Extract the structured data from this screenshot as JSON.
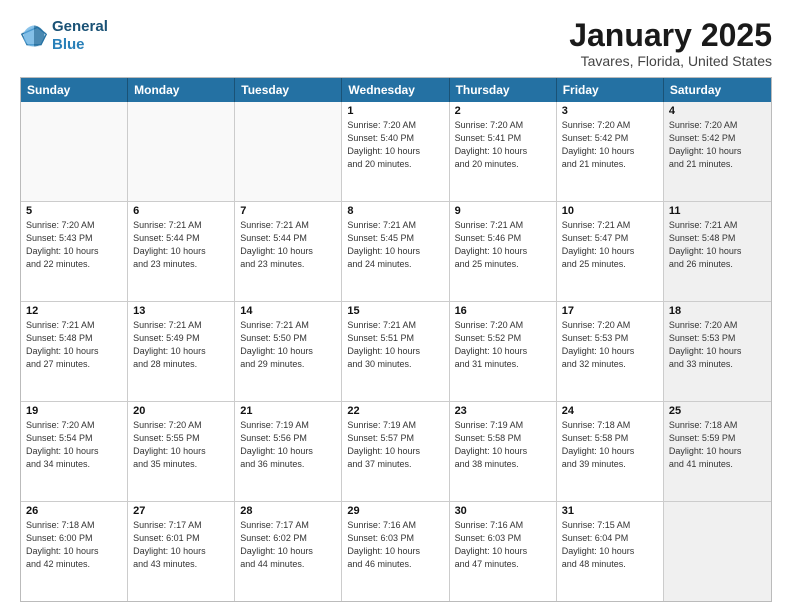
{
  "logo": {
    "line1": "General",
    "line2": "Blue"
  },
  "header": {
    "month": "January 2025",
    "location": "Tavares, Florida, United States"
  },
  "weekdays": [
    "Sunday",
    "Monday",
    "Tuesday",
    "Wednesday",
    "Thursday",
    "Friday",
    "Saturday"
  ],
  "rows": [
    [
      {
        "day": "",
        "info": "",
        "empty": true
      },
      {
        "day": "",
        "info": "",
        "empty": true
      },
      {
        "day": "",
        "info": "",
        "empty": true
      },
      {
        "day": "1",
        "info": "Sunrise: 7:20 AM\nSunset: 5:40 PM\nDaylight: 10 hours\nand 20 minutes."
      },
      {
        "day": "2",
        "info": "Sunrise: 7:20 AM\nSunset: 5:41 PM\nDaylight: 10 hours\nand 20 minutes."
      },
      {
        "day": "3",
        "info": "Sunrise: 7:20 AM\nSunset: 5:42 PM\nDaylight: 10 hours\nand 21 minutes."
      },
      {
        "day": "4",
        "info": "Sunrise: 7:20 AM\nSunset: 5:42 PM\nDaylight: 10 hours\nand 21 minutes.",
        "shaded": true
      }
    ],
    [
      {
        "day": "5",
        "info": "Sunrise: 7:20 AM\nSunset: 5:43 PM\nDaylight: 10 hours\nand 22 minutes."
      },
      {
        "day": "6",
        "info": "Sunrise: 7:21 AM\nSunset: 5:44 PM\nDaylight: 10 hours\nand 23 minutes."
      },
      {
        "day": "7",
        "info": "Sunrise: 7:21 AM\nSunset: 5:44 PM\nDaylight: 10 hours\nand 23 minutes."
      },
      {
        "day": "8",
        "info": "Sunrise: 7:21 AM\nSunset: 5:45 PM\nDaylight: 10 hours\nand 24 minutes."
      },
      {
        "day": "9",
        "info": "Sunrise: 7:21 AM\nSunset: 5:46 PM\nDaylight: 10 hours\nand 25 minutes."
      },
      {
        "day": "10",
        "info": "Sunrise: 7:21 AM\nSunset: 5:47 PM\nDaylight: 10 hours\nand 25 minutes."
      },
      {
        "day": "11",
        "info": "Sunrise: 7:21 AM\nSunset: 5:48 PM\nDaylight: 10 hours\nand 26 minutes.",
        "shaded": true
      }
    ],
    [
      {
        "day": "12",
        "info": "Sunrise: 7:21 AM\nSunset: 5:48 PM\nDaylight: 10 hours\nand 27 minutes."
      },
      {
        "day": "13",
        "info": "Sunrise: 7:21 AM\nSunset: 5:49 PM\nDaylight: 10 hours\nand 28 minutes."
      },
      {
        "day": "14",
        "info": "Sunrise: 7:21 AM\nSunset: 5:50 PM\nDaylight: 10 hours\nand 29 minutes."
      },
      {
        "day": "15",
        "info": "Sunrise: 7:21 AM\nSunset: 5:51 PM\nDaylight: 10 hours\nand 30 minutes."
      },
      {
        "day": "16",
        "info": "Sunrise: 7:20 AM\nSunset: 5:52 PM\nDaylight: 10 hours\nand 31 minutes."
      },
      {
        "day": "17",
        "info": "Sunrise: 7:20 AM\nSunset: 5:53 PM\nDaylight: 10 hours\nand 32 minutes."
      },
      {
        "day": "18",
        "info": "Sunrise: 7:20 AM\nSunset: 5:53 PM\nDaylight: 10 hours\nand 33 minutes.",
        "shaded": true
      }
    ],
    [
      {
        "day": "19",
        "info": "Sunrise: 7:20 AM\nSunset: 5:54 PM\nDaylight: 10 hours\nand 34 minutes."
      },
      {
        "day": "20",
        "info": "Sunrise: 7:20 AM\nSunset: 5:55 PM\nDaylight: 10 hours\nand 35 minutes."
      },
      {
        "day": "21",
        "info": "Sunrise: 7:19 AM\nSunset: 5:56 PM\nDaylight: 10 hours\nand 36 minutes."
      },
      {
        "day": "22",
        "info": "Sunrise: 7:19 AM\nSunset: 5:57 PM\nDaylight: 10 hours\nand 37 minutes."
      },
      {
        "day": "23",
        "info": "Sunrise: 7:19 AM\nSunset: 5:58 PM\nDaylight: 10 hours\nand 38 minutes."
      },
      {
        "day": "24",
        "info": "Sunrise: 7:18 AM\nSunset: 5:58 PM\nDaylight: 10 hours\nand 39 minutes."
      },
      {
        "day": "25",
        "info": "Sunrise: 7:18 AM\nSunset: 5:59 PM\nDaylight: 10 hours\nand 41 minutes.",
        "shaded": true
      }
    ],
    [
      {
        "day": "26",
        "info": "Sunrise: 7:18 AM\nSunset: 6:00 PM\nDaylight: 10 hours\nand 42 minutes."
      },
      {
        "day": "27",
        "info": "Sunrise: 7:17 AM\nSunset: 6:01 PM\nDaylight: 10 hours\nand 43 minutes."
      },
      {
        "day": "28",
        "info": "Sunrise: 7:17 AM\nSunset: 6:02 PM\nDaylight: 10 hours\nand 44 minutes."
      },
      {
        "day": "29",
        "info": "Sunrise: 7:16 AM\nSunset: 6:03 PM\nDaylight: 10 hours\nand 46 minutes."
      },
      {
        "day": "30",
        "info": "Sunrise: 7:16 AM\nSunset: 6:03 PM\nDaylight: 10 hours\nand 47 minutes."
      },
      {
        "day": "31",
        "info": "Sunrise: 7:15 AM\nSunset: 6:04 PM\nDaylight: 10 hours\nand 48 minutes."
      },
      {
        "day": "",
        "info": "",
        "empty": true,
        "shaded": true
      }
    ]
  ]
}
